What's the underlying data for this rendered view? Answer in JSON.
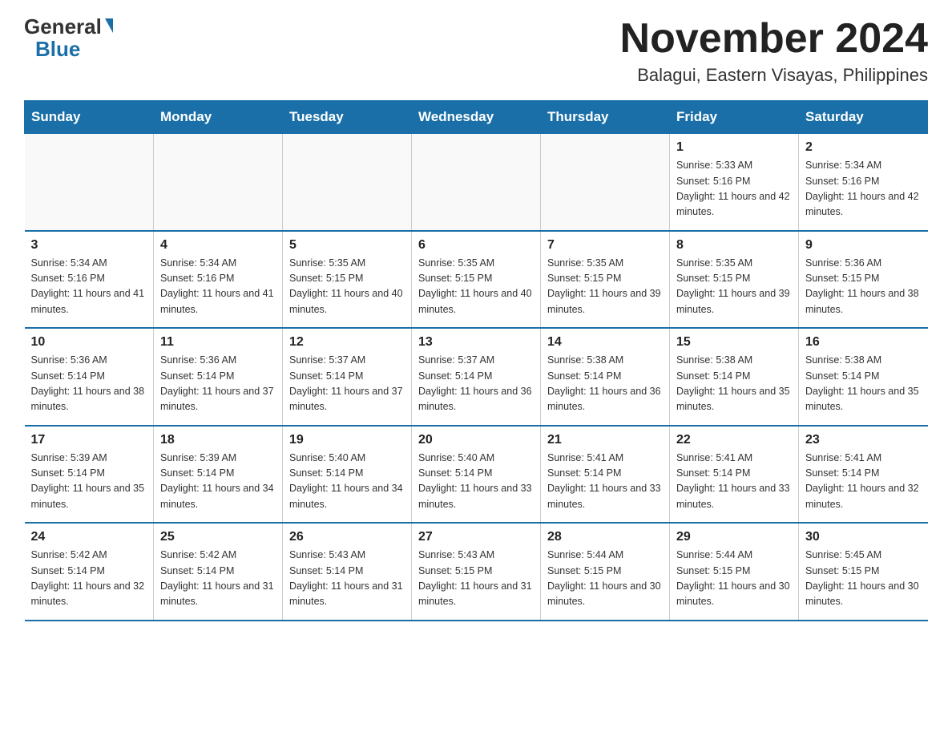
{
  "logo": {
    "general": "General",
    "blue": "Blue"
  },
  "title": "November 2024",
  "subtitle": "Balagui, Eastern Visayas, Philippines",
  "days_header": [
    "Sunday",
    "Monday",
    "Tuesday",
    "Wednesday",
    "Thursday",
    "Friday",
    "Saturday"
  ],
  "weeks": [
    [
      {
        "day": "",
        "info": ""
      },
      {
        "day": "",
        "info": ""
      },
      {
        "day": "",
        "info": ""
      },
      {
        "day": "",
        "info": ""
      },
      {
        "day": "",
        "info": ""
      },
      {
        "day": "1",
        "info": "Sunrise: 5:33 AM\nSunset: 5:16 PM\nDaylight: 11 hours and 42 minutes."
      },
      {
        "day": "2",
        "info": "Sunrise: 5:34 AM\nSunset: 5:16 PM\nDaylight: 11 hours and 42 minutes."
      }
    ],
    [
      {
        "day": "3",
        "info": "Sunrise: 5:34 AM\nSunset: 5:16 PM\nDaylight: 11 hours and 41 minutes."
      },
      {
        "day": "4",
        "info": "Sunrise: 5:34 AM\nSunset: 5:16 PM\nDaylight: 11 hours and 41 minutes."
      },
      {
        "day": "5",
        "info": "Sunrise: 5:35 AM\nSunset: 5:15 PM\nDaylight: 11 hours and 40 minutes."
      },
      {
        "day": "6",
        "info": "Sunrise: 5:35 AM\nSunset: 5:15 PM\nDaylight: 11 hours and 40 minutes."
      },
      {
        "day": "7",
        "info": "Sunrise: 5:35 AM\nSunset: 5:15 PM\nDaylight: 11 hours and 39 minutes."
      },
      {
        "day": "8",
        "info": "Sunrise: 5:35 AM\nSunset: 5:15 PM\nDaylight: 11 hours and 39 minutes."
      },
      {
        "day": "9",
        "info": "Sunrise: 5:36 AM\nSunset: 5:15 PM\nDaylight: 11 hours and 38 minutes."
      }
    ],
    [
      {
        "day": "10",
        "info": "Sunrise: 5:36 AM\nSunset: 5:14 PM\nDaylight: 11 hours and 38 minutes."
      },
      {
        "day": "11",
        "info": "Sunrise: 5:36 AM\nSunset: 5:14 PM\nDaylight: 11 hours and 37 minutes."
      },
      {
        "day": "12",
        "info": "Sunrise: 5:37 AM\nSunset: 5:14 PM\nDaylight: 11 hours and 37 minutes."
      },
      {
        "day": "13",
        "info": "Sunrise: 5:37 AM\nSunset: 5:14 PM\nDaylight: 11 hours and 36 minutes."
      },
      {
        "day": "14",
        "info": "Sunrise: 5:38 AM\nSunset: 5:14 PM\nDaylight: 11 hours and 36 minutes."
      },
      {
        "day": "15",
        "info": "Sunrise: 5:38 AM\nSunset: 5:14 PM\nDaylight: 11 hours and 35 minutes."
      },
      {
        "day": "16",
        "info": "Sunrise: 5:38 AM\nSunset: 5:14 PM\nDaylight: 11 hours and 35 minutes."
      }
    ],
    [
      {
        "day": "17",
        "info": "Sunrise: 5:39 AM\nSunset: 5:14 PM\nDaylight: 11 hours and 35 minutes."
      },
      {
        "day": "18",
        "info": "Sunrise: 5:39 AM\nSunset: 5:14 PM\nDaylight: 11 hours and 34 minutes."
      },
      {
        "day": "19",
        "info": "Sunrise: 5:40 AM\nSunset: 5:14 PM\nDaylight: 11 hours and 34 minutes."
      },
      {
        "day": "20",
        "info": "Sunrise: 5:40 AM\nSunset: 5:14 PM\nDaylight: 11 hours and 33 minutes."
      },
      {
        "day": "21",
        "info": "Sunrise: 5:41 AM\nSunset: 5:14 PM\nDaylight: 11 hours and 33 minutes."
      },
      {
        "day": "22",
        "info": "Sunrise: 5:41 AM\nSunset: 5:14 PM\nDaylight: 11 hours and 33 minutes."
      },
      {
        "day": "23",
        "info": "Sunrise: 5:41 AM\nSunset: 5:14 PM\nDaylight: 11 hours and 32 minutes."
      }
    ],
    [
      {
        "day": "24",
        "info": "Sunrise: 5:42 AM\nSunset: 5:14 PM\nDaylight: 11 hours and 32 minutes."
      },
      {
        "day": "25",
        "info": "Sunrise: 5:42 AM\nSunset: 5:14 PM\nDaylight: 11 hours and 31 minutes."
      },
      {
        "day": "26",
        "info": "Sunrise: 5:43 AM\nSunset: 5:14 PM\nDaylight: 11 hours and 31 minutes."
      },
      {
        "day": "27",
        "info": "Sunrise: 5:43 AM\nSunset: 5:15 PM\nDaylight: 11 hours and 31 minutes."
      },
      {
        "day": "28",
        "info": "Sunrise: 5:44 AM\nSunset: 5:15 PM\nDaylight: 11 hours and 30 minutes."
      },
      {
        "day": "29",
        "info": "Sunrise: 5:44 AM\nSunset: 5:15 PM\nDaylight: 11 hours and 30 minutes."
      },
      {
        "day": "30",
        "info": "Sunrise: 5:45 AM\nSunset: 5:15 PM\nDaylight: 11 hours and 30 minutes."
      }
    ]
  ]
}
